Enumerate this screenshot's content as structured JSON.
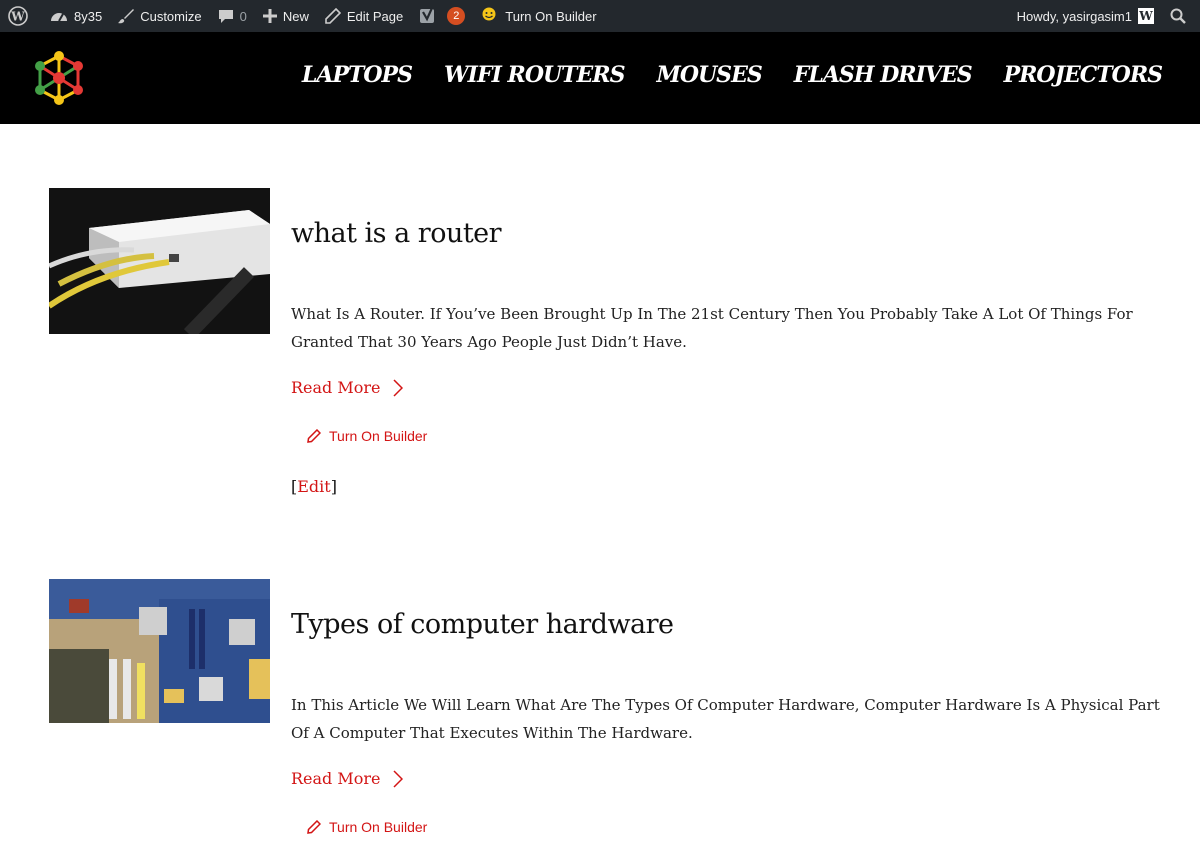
{
  "admin_bar": {
    "site_name": "8y35",
    "customize": "Customize",
    "comments_count": "0",
    "new_label": "New",
    "edit_page": "Edit Page",
    "yoast_count": "2",
    "builder": "Turn On Builder",
    "howdy": "Howdy, yasirgasim1",
    "icons": [
      "wordpress-icon",
      "dashboard-icon",
      "brush-icon",
      "comment-icon",
      "plus-icon",
      "pencil-icon",
      "yoast-icon",
      "builder-icon",
      "search-icon"
    ]
  },
  "nav": {
    "items": [
      "LAPTOPS",
      "WIFI ROUTERS",
      "MOUSES",
      "FLASH DRIVES",
      "PROJECTORS"
    ]
  },
  "posts": [
    {
      "title": "what is a router",
      "excerpt": "What Is A Router. If You’ve Been Brought Up In The 21st Century Then You Probably Take A Lot Of Things For Granted That 30 Years Ago People Just Didn’t Have.",
      "read_more": "Read More",
      "builder": "Turn On Builder",
      "edit": "Edit"
    },
    {
      "title": "Types of computer hardware",
      "excerpt": "In This Article We Will Learn What Are The Types Of Computer Hardware, Computer Hardware Is A Physical Part Of A Computer That Executes Within The Hardware.",
      "read_more": "Read More",
      "builder": "Turn On Builder"
    }
  ],
  "colors": {
    "admin_bar": "#23282d",
    "header": "#000000",
    "accent": "#d31515",
    "badge": "#d54e21"
  }
}
